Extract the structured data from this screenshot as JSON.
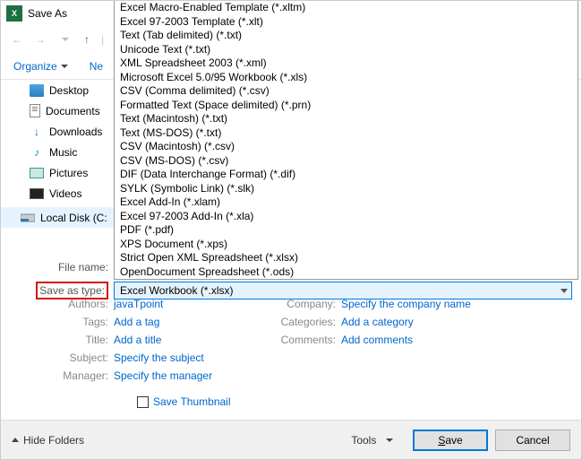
{
  "titlebar": {
    "title": "Save As"
  },
  "toolbar": {
    "organize": "Organize",
    "newfolder_short": "Ne"
  },
  "sidebar": {
    "desktop": "Desktop",
    "documents": "Documents",
    "downloads": "Downloads",
    "music": "Music",
    "pictures": "Pictures",
    "videos": "Videos",
    "localdisk": "Local Disk (C:"
  },
  "filetypes": {
    "items": [
      "Excel Macro-Enabled Template (*.xltm)",
      "Excel 97-2003 Template (*.xlt)",
      "Text (Tab delimited) (*.txt)",
      "Unicode Text (*.txt)",
      "XML Spreadsheet 2003 (*.xml)",
      "Microsoft Excel 5.0/95 Workbook (*.xls)",
      "CSV (Comma delimited) (*.csv)",
      "Formatted Text (Space delimited) (*.prn)",
      "Text (Macintosh) (*.txt)",
      "Text (MS-DOS) (*.txt)",
      "CSV (Macintosh) (*.csv)",
      "CSV (MS-DOS) (*.csv)",
      "DIF (Data Interchange Format) (*.dif)",
      "SYLK (Symbolic Link) (*.slk)",
      "Excel Add-In (*.xlam)",
      "Excel 97-2003 Add-In (*.xla)",
      "PDF (*.pdf)",
      "XPS Document (*.xps)",
      "Strict Open XML Spreadsheet (*.xlsx)",
      "OpenDocument Spreadsheet (*.ods)"
    ],
    "selected": "Excel Workbook (*.xlsx)"
  },
  "labels": {
    "filename": "File name:",
    "saveastype": "Save as type:",
    "authors": "Authors:",
    "tags": "Tags:",
    "title": "Title:",
    "subject": "Subject:",
    "manager": "Manager:",
    "company": "Company:",
    "categories": "Categories:",
    "comments": "Comments:"
  },
  "meta": {
    "authors": "javaTpoint",
    "tags": "Add a tag",
    "title": "Add a title",
    "subject": "Specify the subject",
    "manager": "Specify the manager",
    "company": "Specify the company name",
    "categories": "Add a category",
    "comments": "Add comments"
  },
  "thumb": {
    "label": "Save Thumbnail"
  },
  "bottom": {
    "hide": "Hide Folders",
    "tools": "Tools",
    "save": "Save",
    "cancel": "Cancel"
  }
}
